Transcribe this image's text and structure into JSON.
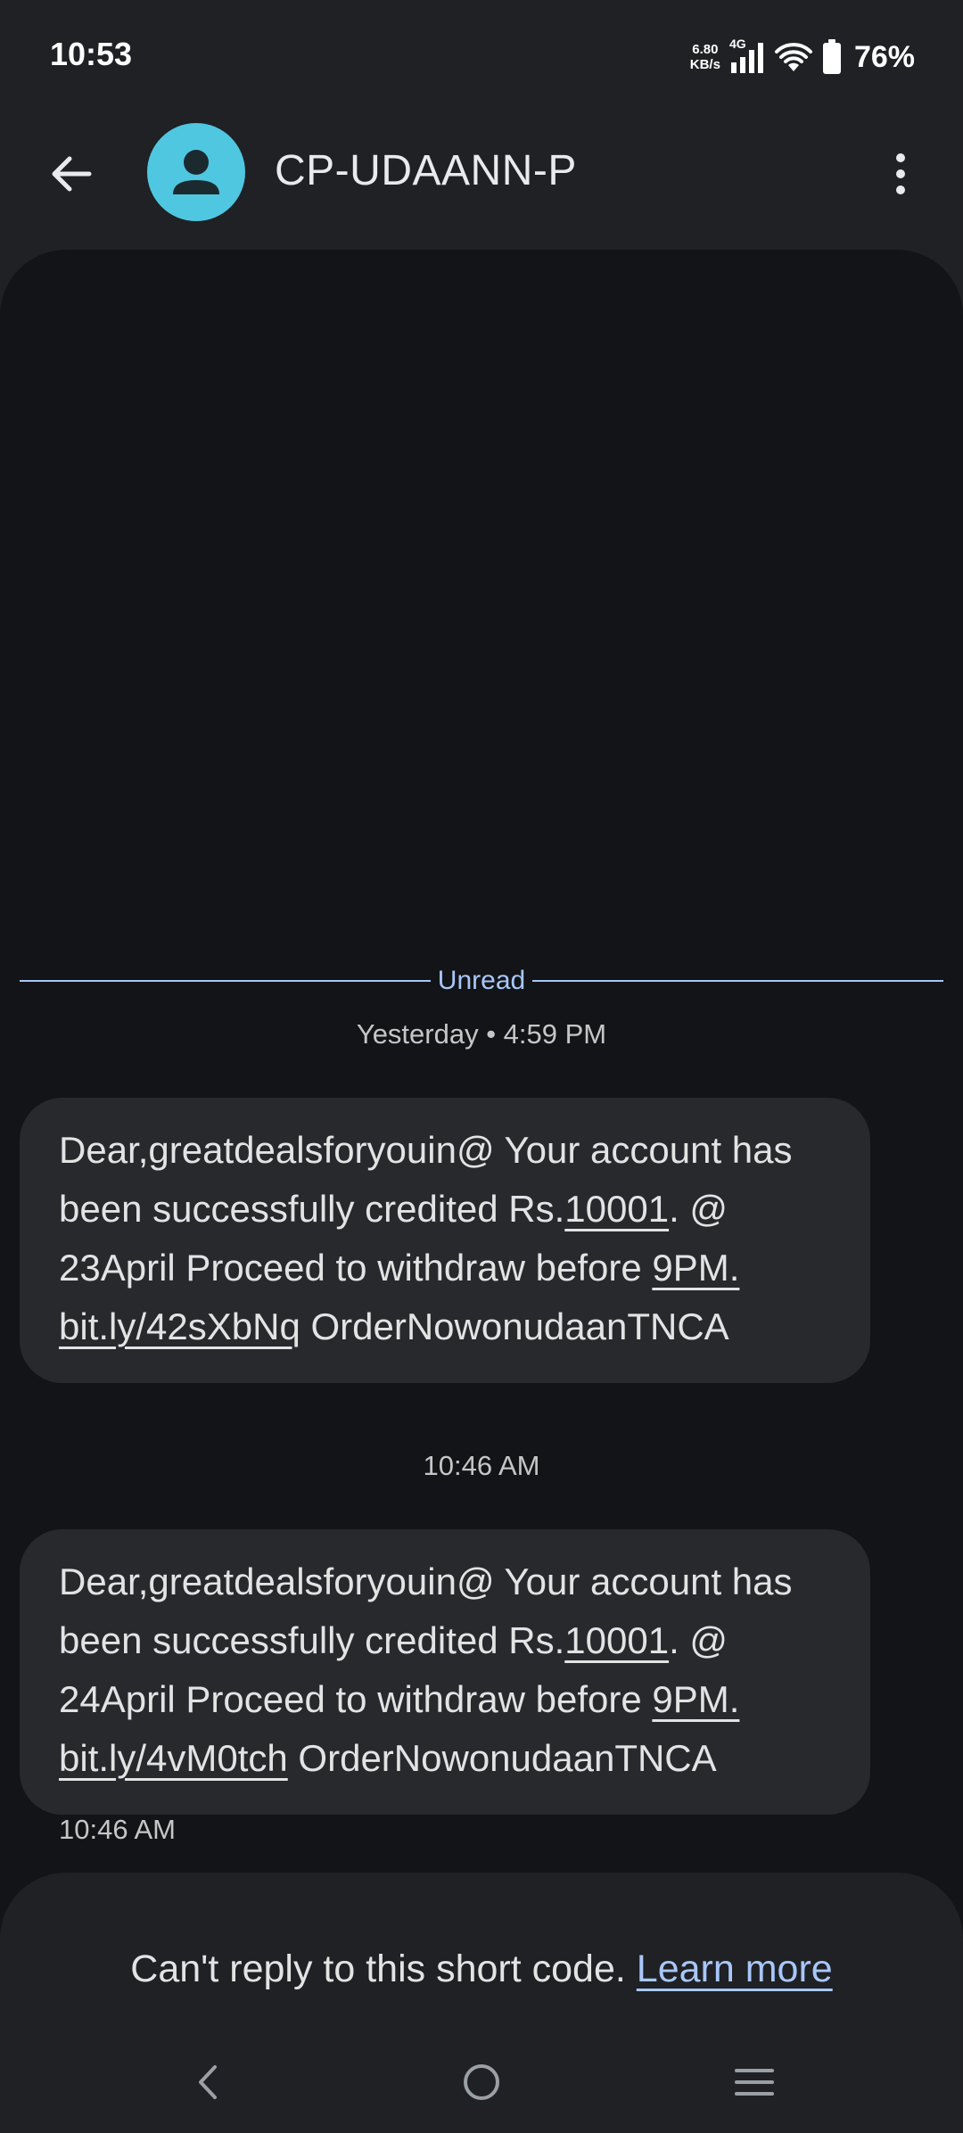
{
  "status_bar": {
    "time": "10:53",
    "net_speed_value": "6.80",
    "net_speed_unit": "KB/s",
    "network_type": "4G",
    "battery_percent": "76%",
    "icons": [
      "signal-icon",
      "wifi-icon",
      "battery-icon"
    ]
  },
  "header": {
    "contact_name": "CP-UDAANN-P",
    "avatar_color": "#4fc7e1",
    "back_icon": "arrow-left-icon",
    "menu_icon": "more-vert-icon"
  },
  "conversation": {
    "unread_label": "Unread",
    "unread_color": "#a8c7fa",
    "messages": [
      {
        "date_header": "Yesterday • 4:59 PM",
        "text": {
          "p1": "Dear,greatdealsforyouin@ Your account has been successfully credited Rs.",
          "amount": "10001",
          "p2": ". @ 23April Proceed to withdraw before ",
          "deadline": "9PM.",
          "p3": " ",
          "link": "bit.ly/42sXbNq",
          "p4": " OrderNowonudaanTNCA"
        }
      },
      {
        "date_header": "10:46 AM",
        "text": {
          "p1": "Dear,greatdealsforyouin@ Your account has been successfully credited Rs.",
          "amount": "10001",
          "p2": ". @ 24April Proceed to withdraw before ",
          "deadline": "9PM.",
          "p3": " ",
          "link": "bit.ly/4vM0tch",
          "p4": " OrderNowonudaanTNCA"
        },
        "time": "10:46 AM"
      }
    ]
  },
  "footer": {
    "notice": "Can't reply to this short code.",
    "learn_more": "Learn more"
  },
  "nav_bar": {
    "icons": [
      "nav-back-icon",
      "nav-home-icon",
      "nav-recents-icon"
    ]
  }
}
